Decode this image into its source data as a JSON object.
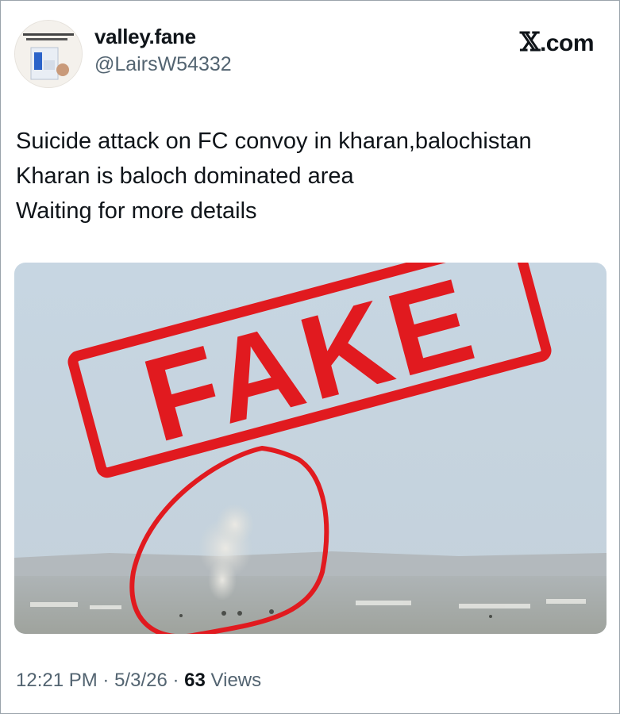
{
  "user": {
    "display_name": "valley.fane",
    "handle": "@LairsW54332",
    "avatar_icon": "profile-avatar"
  },
  "brand": {
    "logo_mark": "𝕏",
    "logo_suffix": ".com"
  },
  "tweet": {
    "lines": [
      "Suicide attack on FC convoy in kharan,balochistan",
      "Kharan is baloch dominated area",
      "Waiting for more details"
    ]
  },
  "media": {
    "stamp_text": "FAKE",
    "stamp_color": "#e11a1f",
    "sky_color": "#c9d6e0"
  },
  "meta": {
    "time": "12:21 PM",
    "date": "5/3/26",
    "views_count": "63",
    "views_label": "Views"
  }
}
